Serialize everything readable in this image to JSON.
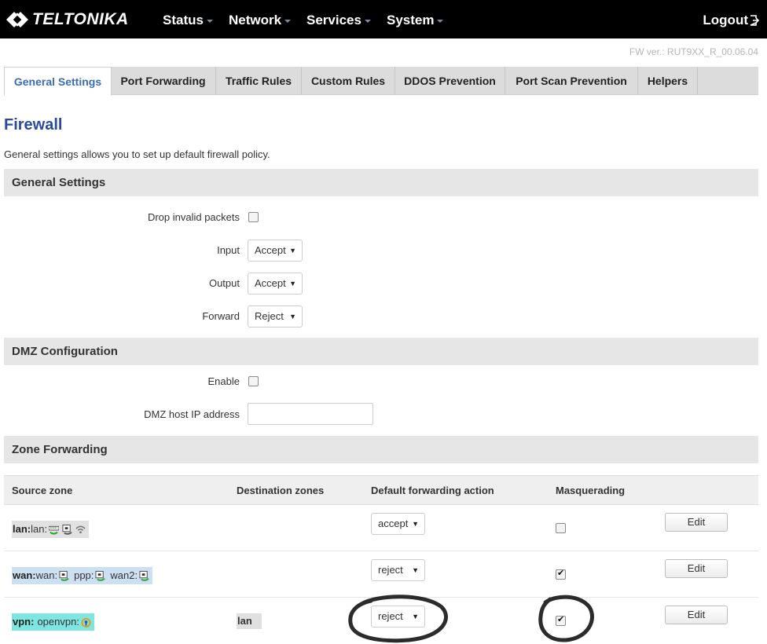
{
  "brand": "TELTONIKA",
  "nav": {
    "items": [
      "Status",
      "Network",
      "Services",
      "System"
    ],
    "logout": "Logout"
  },
  "fw_version": "FW ver.: RUT9XX_R_00.06.04",
  "tabs": [
    "General Settings",
    "Port Forwarding",
    "Traffic Rules",
    "Custom Rules",
    "DDOS Prevention",
    "Port Scan Prevention",
    "Helpers"
  ],
  "page": {
    "title": "Firewall",
    "description": "General settings allows you to set up default firewall policy."
  },
  "general": {
    "heading": "General Settings",
    "drop_invalid_label": "Drop invalid packets",
    "drop_invalid_checked": false,
    "input_label": "Input",
    "input_value": "Accept",
    "output_label": "Output",
    "output_value": "Accept",
    "forward_label": "Forward",
    "forward_value": "Reject"
  },
  "dmz": {
    "heading": "DMZ Configuration",
    "enable_label": "Enable",
    "enable_checked": false,
    "host_label": "DMZ host IP address",
    "host_value": ""
  },
  "zones": {
    "heading": "Zone Forwarding",
    "columns": [
      "Source zone",
      "Destination zones",
      "Default forwarding action",
      "Masquerading"
    ],
    "edit_label": "Edit",
    "rows": [
      {
        "zone": "lan:",
        "networks": [
          {
            "name": "lan:",
            "icons": [
              "switch-icon",
              "ethernet-icon",
              "wifi-icon"
            ]
          }
        ],
        "destination": "",
        "action": "accept",
        "masquerading": false,
        "color": "#e1e1e1"
      },
      {
        "zone": "wan:",
        "networks": [
          {
            "name": "wan:",
            "icons": [
              "ethernet-icon"
            ]
          },
          {
            "name": "ppp:",
            "icons": [
              "ethernet-icon"
            ]
          },
          {
            "name": "wan2:",
            "icons": [
              "ethernet-icon"
            ]
          }
        ],
        "destination": "",
        "action": "reject",
        "masquerading": true,
        "color": "#cde0f2"
      },
      {
        "zone": "vpn:",
        "networks": [
          {
            "name": "openvpn:",
            "icons": [
              "vpn-icon"
            ]
          }
        ],
        "destination": "lan",
        "action": "reject",
        "masquerading": true,
        "color": "#7fe5e0"
      }
    ]
  }
}
